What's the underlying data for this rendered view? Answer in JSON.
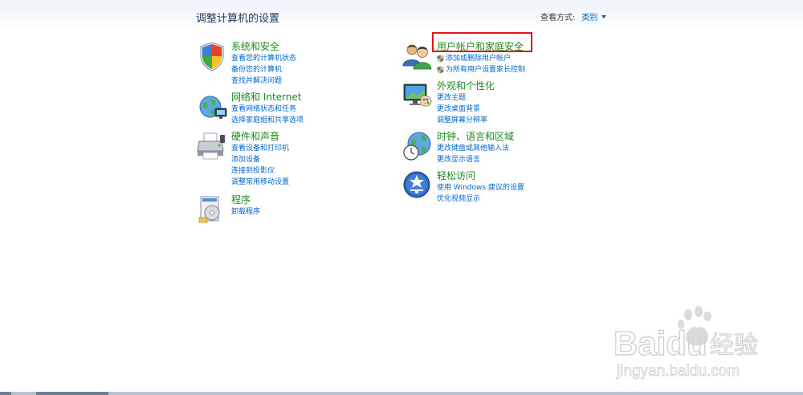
{
  "header": {
    "title": "调整计算机的设置",
    "view_by_label": "查看方式:",
    "view_by_value": "类别"
  },
  "categories": {
    "system_security": {
      "title": "系统和安全",
      "links": [
        "查看您的计算机状态",
        "备份您的计算机",
        "查找并解决问题"
      ]
    },
    "network": {
      "title": "网络和 Internet",
      "links": [
        "查看网络状态和任务",
        "选择家庭组和共享选项"
      ]
    },
    "hardware": {
      "title": "硬件和声音",
      "links": [
        "查看设备和打印机",
        "添加设备",
        "连接到投影仪",
        "调整常用移动设置"
      ]
    },
    "programs": {
      "title": "程序",
      "links": [
        "卸载程序"
      ]
    },
    "user_accounts": {
      "title": "用户帐户和家庭安全",
      "links": [
        "添加或删除用户帐户",
        "为所有用户设置家长控制"
      ]
    },
    "appearance": {
      "title": "外观和个性化",
      "links": [
        "更改主题",
        "更改桌面背景",
        "调整屏幕分辨率"
      ]
    },
    "clock": {
      "title": "时钟、语言和区域",
      "links": [
        "更改键盘或其他输入法",
        "更改显示语言"
      ]
    },
    "ease": {
      "title": "轻松访问",
      "links": [
        "使用 Windows 建议的设置",
        "优化视频显示"
      ]
    }
  },
  "watermark": {
    "brand": "Baidu",
    "product": "经验",
    "url": "jingyan.baidu.com"
  },
  "colors": {
    "category_title": "#1f8a1f",
    "link": "#0066cc",
    "highlight": "#e0161b",
    "page_title": "#1e395b"
  }
}
